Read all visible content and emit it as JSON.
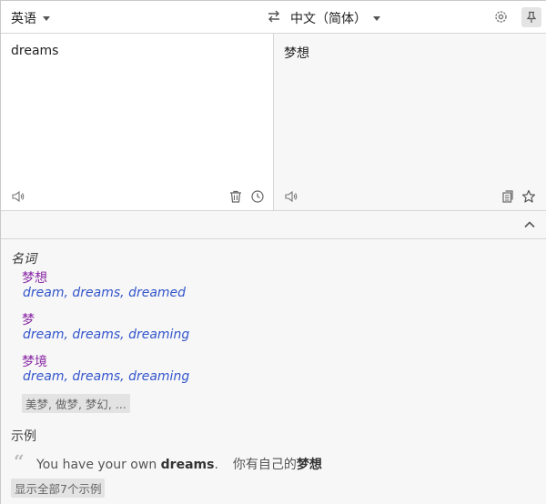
{
  "langbar": {
    "source_lang": "英语",
    "target_lang": "中文（简体）",
    "icons": [
      "swap-icon",
      "gear-icon",
      "pin-icon"
    ]
  },
  "source": {
    "text": "dreams"
  },
  "target": {
    "text": "梦想"
  },
  "dictionary": {
    "part_of_speech": "名词",
    "entries": [
      {
        "word": "梦想",
        "synonyms": [
          "dream",
          "dreams",
          "dreamed"
        ]
      },
      {
        "word": "梦",
        "synonyms": [
          "dream",
          "dreams",
          "dreaming"
        ]
      },
      {
        "word": "梦境",
        "synonyms": [
          "dream",
          "dreams",
          "dreaming"
        ]
      }
    ],
    "more_label": "美梦, 做梦, 梦幻, ...",
    "examples_label": "示例",
    "example": {
      "src_before": "You have your own ",
      "src_bold": "dreams",
      "src_after": ".",
      "tr_before": "你有自己的",
      "tr_bold": "梦想"
    },
    "show_all_label": "显示全部7个示例"
  },
  "colors": {
    "headword": "#8a2aa6",
    "synonym": "#3355cc",
    "panel_bg": "#f7f7f7"
  }
}
